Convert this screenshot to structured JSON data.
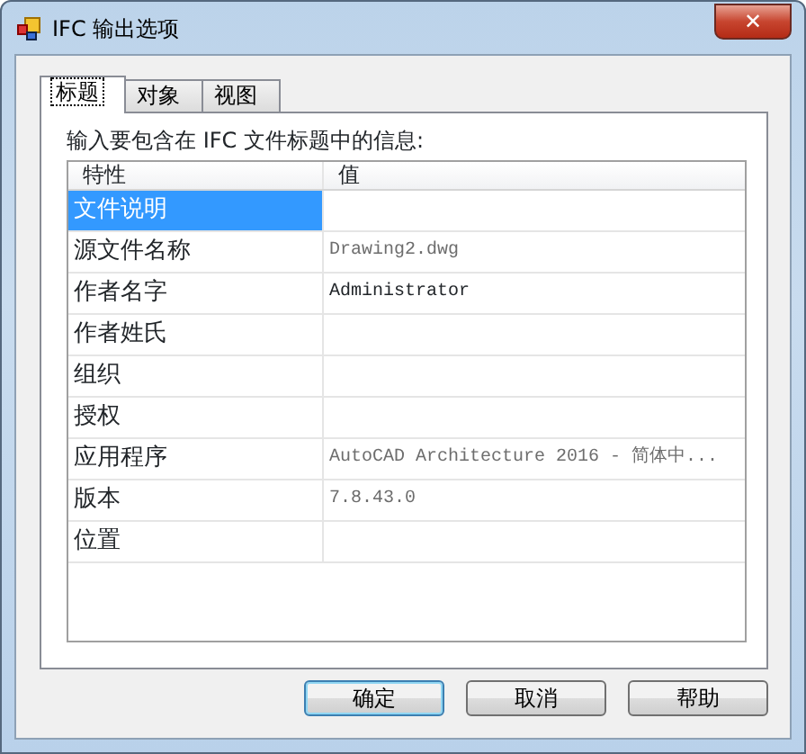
{
  "window": {
    "title": "IFC 输出选项",
    "close": "✕"
  },
  "tabs": [
    {
      "label": "标题",
      "selected": true
    },
    {
      "label": "对象",
      "selected": false
    },
    {
      "label": "视图",
      "selected": false
    }
  ],
  "instruction": "输入要包含在 IFC 文件标题中的信息:",
  "grid": {
    "columns": [
      "特性",
      "值"
    ],
    "rows": [
      {
        "property": "文件说明",
        "selected": true
      },
      {
        "property": "源文件名称",
        "value": "Drawing2.dwg",
        "selected": false,
        "readonly": true
      },
      {
        "property": "作者名字",
        "value": "Administrator",
        "selected": false,
        "readonly": false
      },
      {
        "property": "作者姓氏",
        "selected": false
      },
      {
        "property": "组织",
        "selected": false
      },
      {
        "property": "授权",
        "selected": false
      },
      {
        "property": "应用程序",
        "value": "AutoCAD Architecture 2016 - 简体中...",
        "selected": false,
        "readonly": true
      },
      {
        "property": "版本",
        "value": "7.8.43.0",
        "selected": false,
        "readonly": true
      },
      {
        "property": "位置",
        "selected": false
      }
    ]
  },
  "buttons": [
    {
      "label": "确定",
      "default": true
    },
    {
      "label": "取消",
      "default": false
    },
    {
      "label": "帮助",
      "default": false
    }
  ]
}
